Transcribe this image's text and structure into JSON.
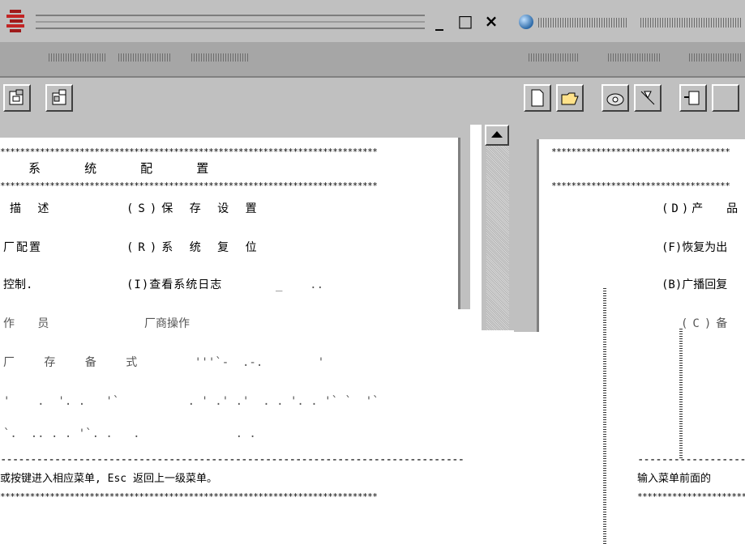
{
  "left_window": {
    "win_controls": {
      "minimize": "_",
      "maximize": "□",
      "close": "×"
    },
    "toolbar_icons": [
      "save-icon",
      "properties-icon"
    ],
    "terminal": {
      "stars_line": "****************************************************************************",
      "heading": " 系  统  配  置",
      "menu_rows": [
        {
          "left": "描 述",
          "right": "(S)保 存 设 置"
        },
        {
          "left": "厂配置",
          "right": "(R)系 统 复 位"
        },
        {
          "left": "控制.",
          "right": "(I)查看系统日志"
        },
        {
          "left": "作 员",
          "right": "厂商操作"
        },
        {
          "left": "厂 存 备 式",
          "right": ""
        }
      ],
      "dash_line": "-----------------------------------------------------------------------------",
      "hint": "或按键进入相应菜单, Esc 返回上一级菜单。"
    }
  },
  "right_window": {
    "toolbar_icons": [
      "new-file-icon",
      "open-folder-icon",
      "phone-icon",
      "hangup-icon",
      "copy-icon"
    ],
    "terminal": {
      "stars_line": "************************************",
      "menu_rows": [
        "(D)产  品",
        "(F)恢复为出",
        "(B)广播回复",
        "(C)备  份"
      ],
      "dash_line": "-----------------------------------",
      "hint": "输入菜单前面的"
    }
  },
  "colors": {
    "chrome": "#c0c0c0",
    "menu_bar": "#a6a6a6",
    "shadow": "#808080",
    "terminal_bg": "#ffffff"
  }
}
